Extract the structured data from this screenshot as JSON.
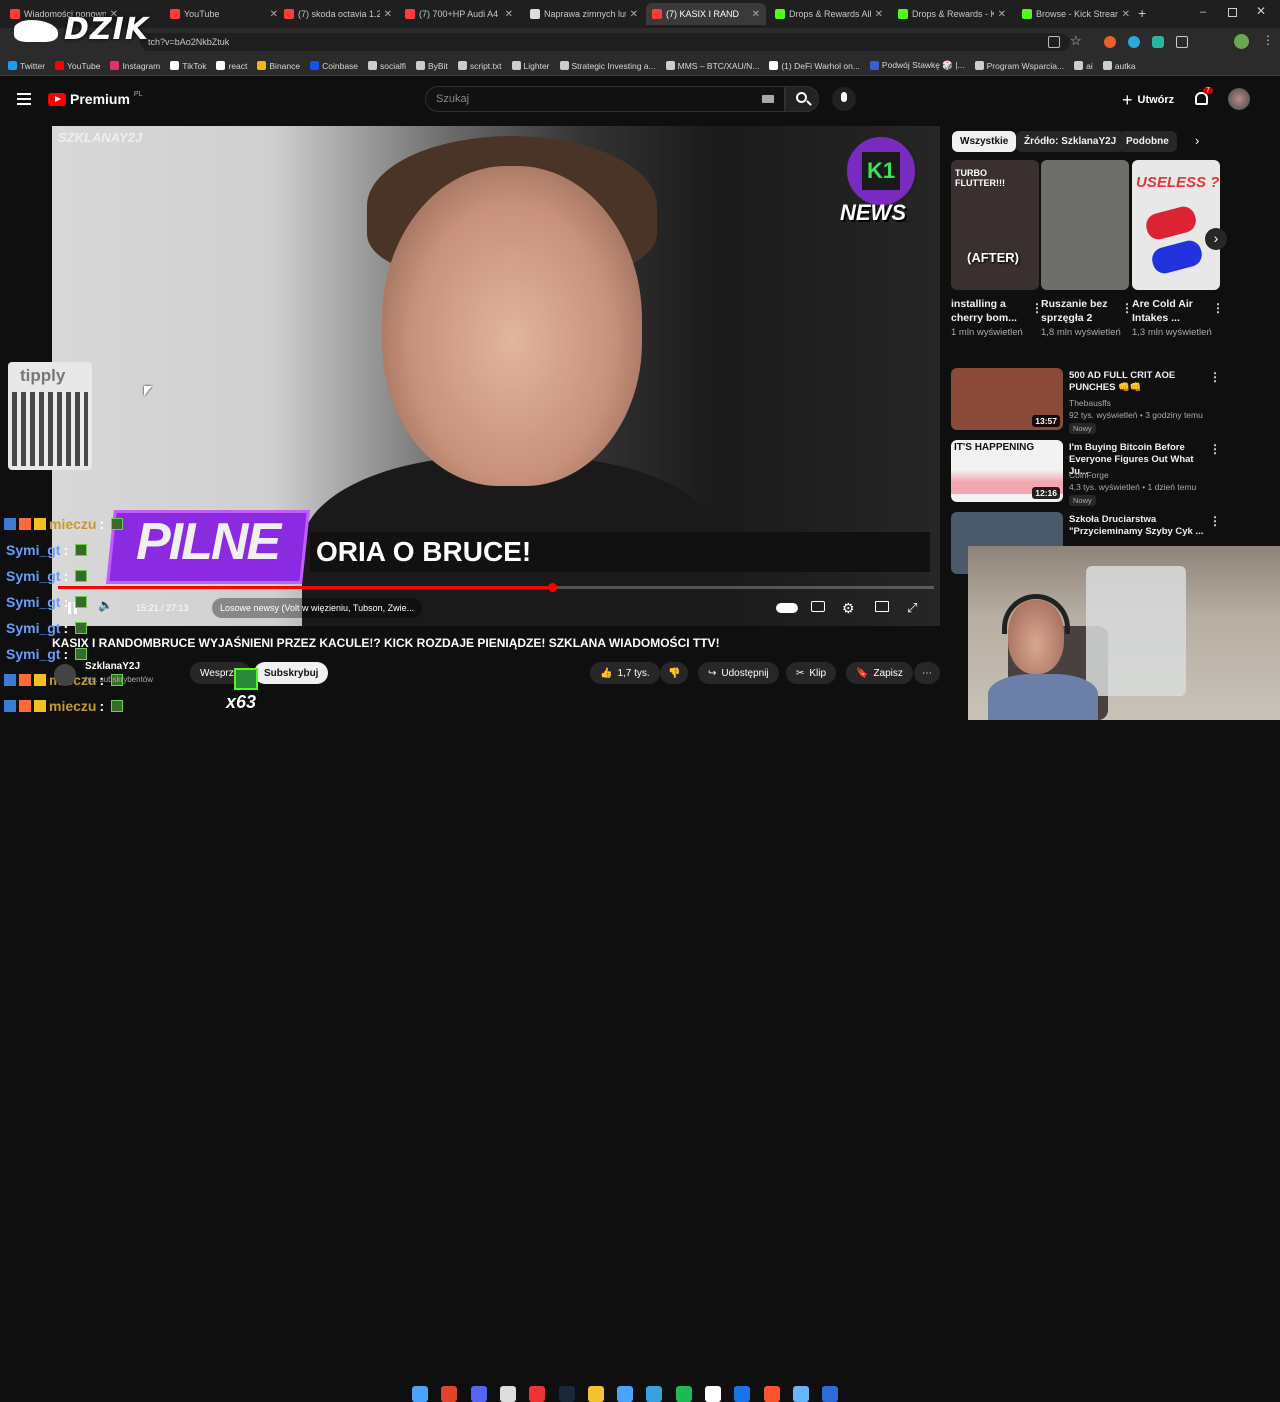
{
  "overlay": {
    "logo_text": "DZIK",
    "x63": "x63"
  },
  "browser": {
    "tabs": [
      {
        "label": "Wiadomości ponownie...",
        "color": "#ff3b3b",
        "active": false
      },
      {
        "label": "YouTube",
        "color": "#ff3b3b",
        "active": false
      },
      {
        "label": "(7) skoda octavia 1.2...",
        "color": "#ff3b3b",
        "active": false
      },
      {
        "label": "(7) 700+HP Audi A4 B...",
        "color": "#ff3b3b",
        "active": false
      },
      {
        "label": "Naprawa zimnych lut...",
        "color": "#dddddd",
        "active": false
      },
      {
        "label": "(7) KASIX I RAND",
        "color": "#ff3b3b",
        "active": true
      },
      {
        "label": "Drops & Rewards All...",
        "color": "#53fc18",
        "active": false
      },
      {
        "label": "Drops & Rewards - K...",
        "color": "#53fc18",
        "active": false
      },
      {
        "label": "Browse - Kick Stream...",
        "color": "#53fc18",
        "active": false
      }
    ],
    "new_tab": "+",
    "url": "tch?v=bAo2NkbZtuk",
    "bookmarks": [
      {
        "label": "Twitter",
        "color": "#1d9bf0"
      },
      {
        "label": "YouTube",
        "color": "#ff0000"
      },
      {
        "label": "Instagram",
        "color": "#e1306c"
      },
      {
        "label": "TikTok",
        "color": "#ffffff"
      },
      {
        "label": "react",
        "color": "#ffffff"
      },
      {
        "label": "Binance",
        "color": "#f0b90b"
      },
      {
        "label": "Coinbase",
        "color": "#1652f0"
      },
      {
        "label": "socialfi",
        "color": "#cccccc"
      },
      {
        "label": "ByBit",
        "color": "#cccccc"
      },
      {
        "label": "script.txt",
        "color": "#cccccc"
      },
      {
        "label": "Lighter",
        "color": "#cccccc"
      },
      {
        "label": "Strategic Investing a...",
        "color": "#cccccc"
      },
      {
        "label": "MMS – BTC/XAU/N...",
        "color": "#cccccc"
      },
      {
        "label": "(1) DeFi Warhol on...",
        "color": "#ffffff"
      },
      {
        "label": "Podwój Stawkę 🎲 |...",
        "color": "#3b5bdb"
      },
      {
        "label": "Program Wsparcia...",
        "color": "#cccccc"
      },
      {
        "label": "ai",
        "color": "#cccccc"
      },
      {
        "label": "autka",
        "color": "#cccccc"
      }
    ]
  },
  "yt_header": {
    "logo": "Premium",
    "logo_sup": "PL",
    "search_placeholder": "Szukaj",
    "create_label": "Utwórz",
    "notif_count": "7"
  },
  "video": {
    "watermark": "SZKLANAY2J",
    "k1_inner": "K1",
    "k1_label": "NEWS",
    "banner_tag": "PILNE",
    "banner_text": "ORIA O BRUCE!",
    "time": "15:21 / 27:13",
    "chapter": "Losowe newsy (Volt w więzieniu, Tubson, Zwie...",
    "progress": 0.5636
  },
  "tipply": {
    "logo": "tipply"
  },
  "chat": [
    {
      "name": "mieczu",
      "style": "n1"
    },
    {
      "name": "Symi_gt",
      "style": "n2"
    },
    {
      "name": "Symi_gt",
      "style": "n2"
    },
    {
      "name": "Symi_gt",
      "style": "n2"
    },
    {
      "name": "Symi_gt",
      "style": "n2"
    },
    {
      "name": "Symi_gt",
      "style": "n2"
    },
    {
      "name": "mieczu",
      "style": "n1"
    },
    {
      "name": "mieczu",
      "style": "n1"
    }
  ],
  "below": {
    "title": "KASIX I RANDOMBRUCE WYJAŚNIENI PRZEZ KACULE!? KICK ROZDAJE PIENIĄDZE! SZKLANA WIADOMOŚCI TTV!",
    "channel": "SzklanaY2J",
    "subs": "tys. subskrybentów",
    "support": "Wesprzyj",
    "subscribe": "Subskrybuj",
    "likes": "1,7 tys.",
    "share": "Udostępnij",
    "clip": "Klip",
    "save": "Zapisz"
  },
  "sidebar": {
    "chips": [
      "Wszystkie",
      "Źródło: SzklanaY2J",
      "Podobne"
    ],
    "shorts": [
      {
        "overlay": "TURBO FLUTTER!!!",
        "overlay2": "(AFTER)",
        "title": "installing a cherry bom...",
        "views": "1 mln wyświetleń",
        "bg": "#3a3030"
      },
      {
        "overlay": "",
        "overlay2": "",
        "title": "Ruszanie bez sprzęgła 2",
        "views": "1,8 mln wyświetleń",
        "bg": "#6e6e6a"
      },
      {
        "overlay": "USELESS ?",
        "overlay2": "",
        "title": "Are Cold Air Intakes ...",
        "views": "1,3 mln wyświetleń",
        "bg": "#e8e8e8"
      }
    ],
    "recs": [
      {
        "title": "500 AD FULL CRIT AOE PUNCHES 👊👊",
        "channel": "Thebausffs",
        "views": "92 tys. wyświetleń • 3 godziny temu",
        "badge": "Nowy",
        "duration": "13:57",
        "thumb_text": "",
        "bg": "#8a4a3a"
      },
      {
        "title": "I'm Buying Bitcoin Before Everyone Figures Out What Ju...",
        "channel": "CoinForge",
        "views": "4,3 tys. wyświetleń • 1 dzień temu",
        "badge": "Nowy",
        "duration": "12:16",
        "thumb_text": "IT'S HAPPENING",
        "bg": "#f2f2f2"
      },
      {
        "title": "Szkoła Druciarstwa \"Przycieminamy Szyby Cyk ...",
        "channel": "",
        "views": "",
        "badge": "",
        "duration": "",
        "thumb_text": "",
        "bg": "#4a5a6a"
      }
    ]
  }
}
